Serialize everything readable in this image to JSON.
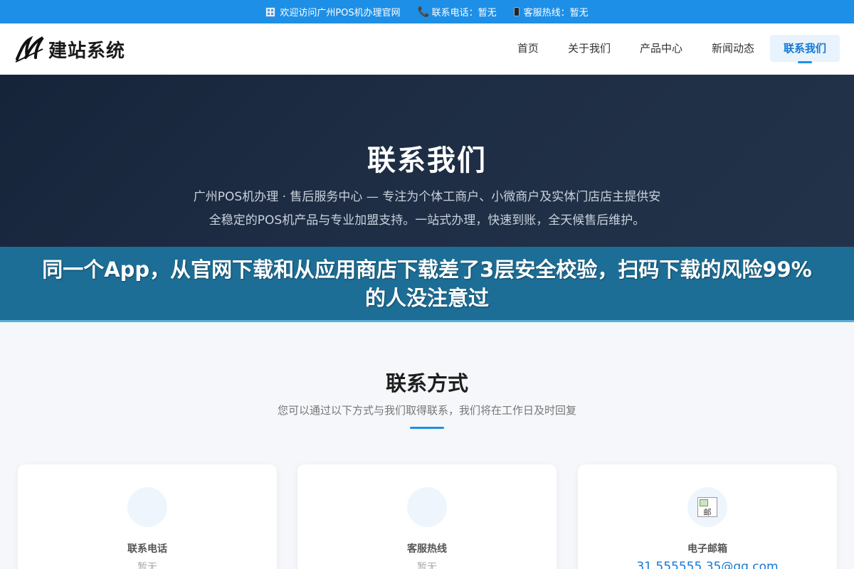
{
  "topbar": {
    "welcome": "欢迎访问广州POS机办理官网",
    "phone": "联系电话：暂无",
    "hotline": "客服热线：暂无",
    "colors": {
      "background": "#1e8fe6"
    }
  },
  "header": {
    "logo_text": "建站系统",
    "nav": [
      {
        "label": "首页",
        "active": false
      },
      {
        "label": "关于我们",
        "active": false
      },
      {
        "label": "产品中心",
        "active": false
      },
      {
        "label": "新闻动态",
        "active": false
      },
      {
        "label": "联系我们",
        "active": true
      }
    ]
  },
  "hero": {
    "title": "联系我们",
    "description": "广州POS机办理 · 售后服务中心 — 专注为个体工商户、小微商户及实体门店店主提供安全稳定的POS机产品与专业加盟支持。一站式办理，快速到账，全天候售后维护。"
  },
  "banner": {
    "text": "同一个App，从官网下载和从应用商店下载差了3层安全校验，扫码下载的风险99%的人没注意过",
    "colors": {
      "background": "#1d6e96"
    }
  },
  "contact": {
    "title": "联系方式",
    "subtitle": "您可以通过以下方式与我们取得联系，我们将在工作日及时回复",
    "cards": [
      {
        "icon": "phone-icon",
        "label": "联系电话",
        "value": "暂无"
      },
      {
        "icon": "headset-icon",
        "label": "客服热线",
        "value": "暂无"
      },
      {
        "icon": "mail-icon",
        "icon_alt": "邮",
        "label": "电子邮箱",
        "value": "31.555555.35@qq.com"
      }
    ]
  }
}
